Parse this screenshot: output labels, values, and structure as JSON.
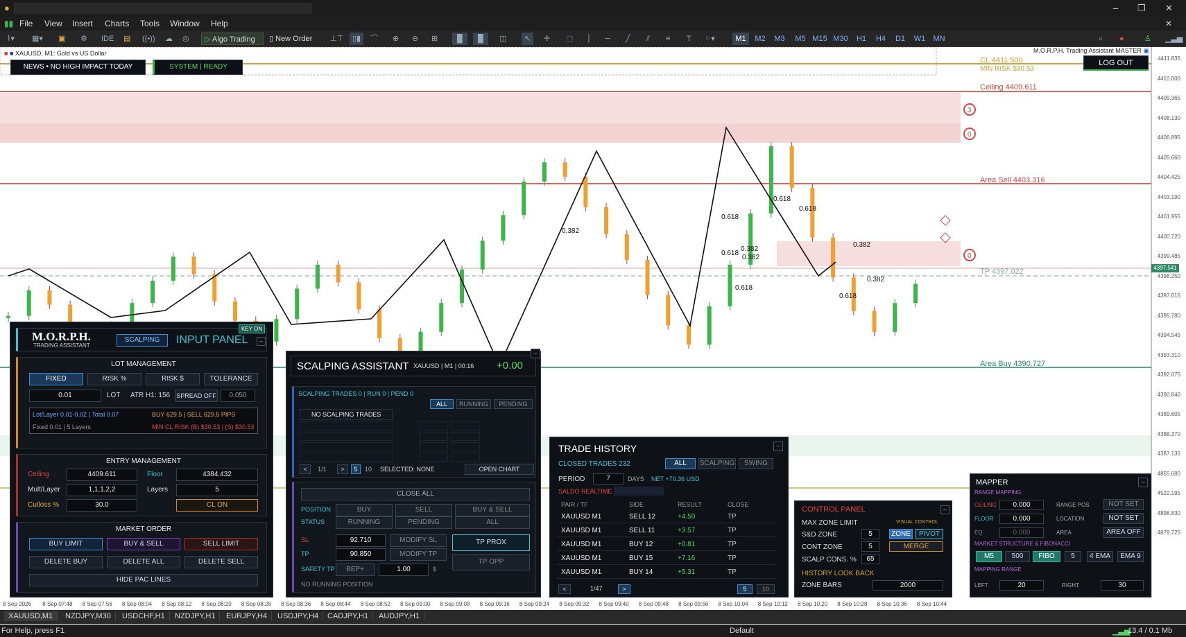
{
  "menu": [
    "File",
    "View",
    "Insert",
    "Charts",
    "Tools",
    "Window",
    "Help"
  ],
  "toolbar": {
    "algo": "Algo Trading",
    "new_order": "New Order",
    "ide": "IDE",
    "timeframes": [
      "M1",
      "M2",
      "M3",
      "M5",
      "M15",
      "M30",
      "H1",
      "H4",
      "D1",
      "W1",
      "MN"
    ],
    "active_tf": "M1"
  },
  "chart": {
    "symbol": "XAUUSD, M1:  Gold vs US Dollar",
    "ea_name": "M.O.R.P.H. Trading Assistant MASTER",
    "news": "NEWS • NO HIGH IMPACT TODAY",
    "system": "SYSTEM",
    "ready": "READY",
    "logout": "LOG OUT",
    "levels": {
      "cl": "CL 4411.500",
      "min_risk": "MIN RISK $30.53",
      "ceiling": "Ceiling 4409.611",
      "area_sell": "Area Sell 4403.316",
      "tp": "TP 4397.022",
      "area_buy": "Area Buy 4390.727"
    },
    "fib_labels": [
      "0.382",
      "0.618",
      "0.618",
      "0.382",
      "0.618",
      "0.382",
      "0.382",
      "0.618",
      "0.618",
      "0.382",
      "0.618"
    ],
    "price_tag": "4397.541",
    "y_labels": [
      "4411.835",
      "4410.600",
      "4409.365",
      "4408.130",
      "4406.895",
      "4405.660",
      "4404.425",
      "4403.190",
      "4401.955",
      "4400.720",
      "4399.485",
      "4398.250",
      "4397.015",
      "4395.780",
      "4394.545",
      "4393.310",
      "4392.075",
      "4390.840",
      "4389.605",
      "4388.370",
      "4387.135",
      "4855.680",
      "4522.195",
      "4898.830",
      "4879.725"
    ],
    "x_labels": [
      "8 Sep 2026",
      "8 Sep 07:48",
      "8 Sep 07:56",
      "8 Sep 08:04",
      "8 Sep 08:12",
      "8 Sep 08:20",
      "8 Sep 08:28",
      "8 Sep 08:36",
      "8 Sep 08:44",
      "8 Sep 08:52",
      "8 Sep 09:00",
      "8 Sep 09:08",
      "8 Sep 09:16",
      "8 Sep 09:24",
      "8 Sep 09:32",
      "8 Sep 09:40",
      "8 Sep 09:48",
      "8 Sep 09:56",
      "8 Sep 10:04",
      "8 Sep 10:12",
      "8 Sep 10:20",
      "8 Sep 10:28",
      "8 Sep 10:36",
      "8 Sep 10:44"
    ],
    "zone_markers": [
      "3",
      "0",
      "0"
    ],
    "candle_values": [
      4395.2,
      4396.8,
      4395.9,
      4394.1,
      4393.0,
      4394.6,
      4396.0,
      4397.4,
      4398.9,
      4397.8,
      4396.1,
      4394.9,
      4393.6,
      4395.0,
      4396.9,
      4398.4,
      4397.3,
      4395.6,
      4393.8,
      4392.5,
      4394.2,
      4396.0,
      4398.1,
      4399.9,
      4401.5,
      4403.6,
      4404.8,
      4403.9,
      4402.0,
      4400.3,
      4398.7,
      4396.5,
      4394.6,
      4393.4,
      4395.8,
      4398.4,
      4401.6,
      4405.8,
      4403.2,
      4400.1,
      4397.6,
      4395.5,
      4394.2,
      4396.0,
      4397.2
    ]
  },
  "input_panel": {
    "brand": "M.O.R.P.H.",
    "brand_sub": "TRADING ASSISTANT",
    "mode": "SCALPING",
    "title": "INPUT PANEL",
    "key": "KEY ON",
    "lot_mgmt": "LOT MANAGEMENT",
    "lot_tabs": [
      "FIXED",
      "RISK %",
      "RISK $",
      "TOLERANCE"
    ],
    "lot_value": "0.01",
    "lot_label": "LOT",
    "atr": "ATR H1: 156",
    "spread_btn": "SPREAD OFF",
    "spread_val": "0.050",
    "info1": "Lot/Layer 0.01-0.02 | Total 0.07",
    "info1b": "BUY 629.5 | SELL 629.5 PIPS",
    "info2": "Fixed 0.01 | 5 Layers",
    "info2b": "MIN CL RISK (B) $30.53 | (S) $30.53",
    "entry_mgmt": "ENTRY MANAGEMENT",
    "ceiling_lbl": "Ceiling",
    "ceiling_val": "4409.611",
    "floor_lbl": "Floor",
    "floor_val": "4384.432",
    "mult_lbl": "Mult/Layer",
    "mult_val": "1,1,1,2,2",
    "layers_lbl": "Layers",
    "layers_val": "5",
    "cutloss_lbl": "Cutloss %",
    "cutloss_val": "30.0",
    "cl_btn": "CL ON",
    "market_order": "MARKET ORDER",
    "mo_row1": [
      "BUY LIMIT",
      "BUY & SELL",
      "SELL LIMIT"
    ],
    "mo_row2": [
      "DELETE BUY",
      "DELETE ALL",
      "DELETE SELL"
    ],
    "hide_pac": "HIDE PAC LINES"
  },
  "scalping": {
    "title": "SCALPING ASSISTANT",
    "sub": "XAUUSD | M1 | 00:16",
    "pnl": "+0.00",
    "summary": "SCALPING TRADES 0 | RUN 0 | PEND 0",
    "filters": [
      "ALL",
      "RUNNING",
      "PENDING"
    ],
    "empty": "NO SCALPING TRADES",
    "page": "1/1",
    "nav_prev": "<",
    "nav_next": ">",
    "size5": "5",
    "size10": "10",
    "selected": "SELECTED: NONE",
    "open_chart": "OPEN CHART",
    "close_all": "CLOSE ALL",
    "position_lbl": "POSITION",
    "pos_opts": [
      "BUY",
      "SELL",
      "BUY & SELL"
    ],
    "status_lbl": "STATUS",
    "status_opts": [
      "RUNNING",
      "PENDING",
      "ALL"
    ],
    "sl_lbl": "SL",
    "sl_val": "92.710",
    "modify_sl": "MODIFY SL",
    "tp_lbl": "TP",
    "tp_val": "90.850",
    "modify_tp": "MODIFY TP",
    "tp_prox": "TP PROX",
    "tp_opp": "TP OPP",
    "safety_lbl": "SAFETY TP",
    "bep": "BEP+",
    "safety_val": "1.00",
    "safety_unit": "$",
    "no_running": "NO RUNNING POSITION"
  },
  "history": {
    "title": "TRADE HISTORY",
    "closed": "CLOSED TRADES 232",
    "filters": [
      "ALL",
      "SCALPING",
      "SWING"
    ],
    "period_lbl": "PERIOD",
    "period_val": "7",
    "days": "DAYS",
    "net": "NET +70.36 USD",
    "saldo": "SALDO REALTIME",
    "cols": [
      "PAIR / TF",
      "SIDE",
      "RESULT",
      "CLOSE"
    ],
    "rows": [
      {
        "pair": "XAUUSD M1",
        "side": "SELL 12",
        "result": "+4.50",
        "close": "TP"
      },
      {
        "pair": "XAUUSD M1",
        "side": "SELL 11",
        "result": "+3.57",
        "close": "TP"
      },
      {
        "pair": "XAUUSD M1",
        "side": "BUY 12",
        "result": "+0.81",
        "close": "TP"
      },
      {
        "pair": "XAUUSD M1",
        "side": "BUY 15",
        "result": "+7.16",
        "close": "TP"
      },
      {
        "pair": "XAUUSD M1",
        "side": "BUY 14",
        "result": "+5.31",
        "close": "TP"
      }
    ],
    "page": "1/47",
    "prev": "<",
    "next": ">",
    "s5": "5",
    "s10": "10"
  },
  "control": {
    "title": "CONTROL PANEL",
    "max_zone": "MAX ZONE LIMIT",
    "visual": "VISUAL CONTROL",
    "sd_lbl": "S&D ZONE",
    "sd_val": "5",
    "zone_btn": "ZONE",
    "pivot_btn": "PIVOT",
    "cont_lbl": "CONT ZONE",
    "cont_val": "5",
    "merge_btn": "MERGE",
    "scalp_lbl": "SCALP CONS. %",
    "scalp_val": "65",
    "lookback": "HISTORY LOOK BACK",
    "bars_lbl": "ZONE BARS",
    "bars_val": "2000"
  },
  "mapper": {
    "title": "MAPPER",
    "range_map": "RANGE MAPPING",
    "ceiling_lbl": "CEILING",
    "ceiling_val": "0.000",
    "range_pos": "RANGE POS",
    "not_set1": "NOT SET",
    "floor_lbl": "FLOOR",
    "floor_val": "0.000",
    "location": "LOCATION",
    "not_set2": "NOT SET",
    "eq_lbl": "EQ",
    "eq_val": "0.000",
    "area": "AREA",
    "area_off": "AREA OFF",
    "ms_fib": "MARKET STRUCTURE & FIBONACCI",
    "ms_btns": [
      "M5",
      "500",
      "FIBO",
      "5",
      "4 EMA",
      "EMA 9"
    ],
    "map_range": "MAPPING RANGE",
    "left_lbl": "LEFT",
    "left_val": "20",
    "right_lbl": "RIGHT",
    "right_val": "30"
  },
  "tabs": [
    "XAUUSD,M1",
    "NZDJPY,M30",
    "USDCHF,H1",
    "NZDJPY,H1",
    "EURJPY,H4",
    "USDJPY,H4",
    "CADJPY,H1",
    "AUDJPY,H1"
  ],
  "status": {
    "help": "For Help, press F1",
    "profile": "Default",
    "net": "13.4 / 0.1 Mb"
  }
}
